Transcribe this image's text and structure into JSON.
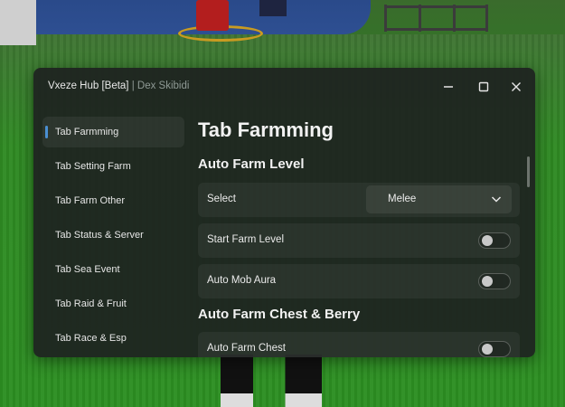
{
  "window": {
    "title": "Vxeze Hub [Beta]",
    "subtitle": "| Dex Skibidi",
    "controls": {
      "minimize_icon": "minimize-icon",
      "maximize_icon": "maximize-icon",
      "close_icon": "close-icon"
    }
  },
  "sidebar": {
    "items": [
      {
        "label": "Tab Farmming",
        "active": true
      },
      {
        "label": "Tab Setting Farm"
      },
      {
        "label": "Tab Farm Other"
      },
      {
        "label": "Tab Status & Server"
      },
      {
        "label": "Tab Sea Event"
      },
      {
        "label": "Tab Raid & Fruit"
      },
      {
        "label": "Tab Race & Esp"
      }
    ]
  },
  "main": {
    "title": "Tab Farmming",
    "sections": [
      {
        "title": "Auto Farm Level",
        "rows": [
          {
            "type": "dropdown",
            "label": "Select",
            "value": "Melee"
          },
          {
            "type": "toggle",
            "label": "Start Farm Level",
            "on": false
          },
          {
            "type": "toggle",
            "label": "Auto Mob Aura",
            "on": false
          }
        ]
      },
      {
        "title": "Auto Farm Chest & Berry",
        "rows": [
          {
            "type": "toggle",
            "label": "Auto Farm Chest",
            "on": false
          }
        ]
      }
    ]
  },
  "colors": {
    "accent": "#4a8fd1",
    "window_bg": "#1e2220",
    "row_bg": "#2a2e2c"
  }
}
